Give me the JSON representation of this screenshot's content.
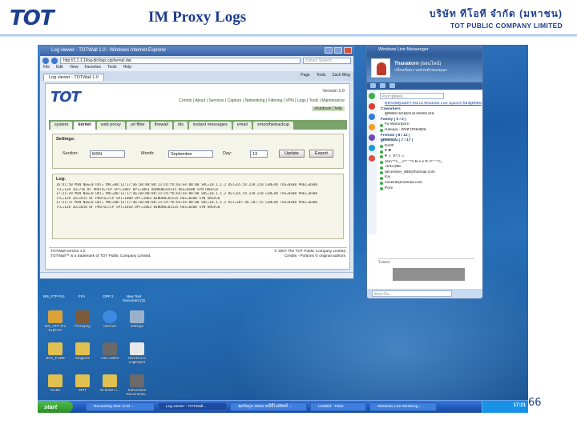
{
  "slide": {
    "logo": "TOT",
    "title": "IM Proxy Logs",
    "company_thai": "บริษัท ทีโอที จำกัด (มหาชน)",
    "company_eng": "TOT PUBLIC COMPANY LIMITED",
    "page_number": "66"
  },
  "browser": {
    "window_title": "Log viewer - TOTWall 1.0 - Windows Internet Explorer",
    "url": "http://1.1.1.1/log-dir/logs.cgi/kernel.dat",
    "search_placeholder": "Yahoo! Search",
    "menu": [
      "File",
      "Edit",
      "View",
      "Favorites",
      "Tools",
      "Help"
    ],
    "tab_label": "Log viewer - TOTWall 1.0",
    "tools": [
      "Page",
      "Tools",
      "Zach Blog"
    ]
  },
  "totwall": {
    "logo": "TOT",
    "version": "Version 1.0",
    "nav": "Control | About | Services | Capture | Networking | Filtering | VPN | Logs | Tools | Maintenance",
    "user_bar": "shutdown | help",
    "tabs": [
      "system",
      "kernel",
      "web proxy",
      "url filter",
      "firewall",
      "ids",
      "instant messages",
      "email",
      "smoothiebackup"
    ],
    "active_tab": "instant messages",
    "settings_title": "Settings:",
    "section_label": "Section:",
    "section_value": "MSN",
    "month_label": "Month:",
    "month_value": "September",
    "day_label": "Day:",
    "day_value": "13",
    "update_button": "Update",
    "export_button": "Export",
    "log_title": "Log:",
    "log_lines": [
      "16:41:50 MSN New=0 OUT= MAC=00:12:17:a6:a0:88:00:13:c4:fb:6a:ee:08:00 SRC=10.1.1.2 DST=65.54.239.210 LEN=48 TOS=0x00 PREC=0x00",
      "TTL=128 ID=716 DF PROTO=TCP SPT=1807 DPT=1863 WINDOW=65535 RES=0x00 SYN URGP=0",
      "17:21:29 MSN New=0 OUT= MAC=00:13:17:a6:a0:88:00:13:c4:fb:6a:ee:08:00 SRC=10.1.1.2 DST=65.54.239.210 LEN=48 TOS=0x00 PREC=0x00",
      "TTL=128 ID=1915 DF PROTO=TCP SPT=1809 DPT=1863 WINDOW=65535 RES=0x00 SYN URGP=0",
      "17:21:37 MSN New=0 OUT= MAC=00:13:17:a6:a0:88:00:13:c4:fb:6a:ee:08:00 SRC=10.1.1.2 DST=207.46.107.55 LEN=48 TOS=0x00 PREC=0x00",
      "TTL=128 ID=1818 DF PROTO=TCP SPT=1810 DPT=1863 WINDOW=65535 RES=0x00 SYN URGP=0"
    ],
    "footer_left_1": "TOTWall version 1.0",
    "footer_left_2": "TOTWall™ is a trademark of TOT Public Company Limited.",
    "footer_right_1": "© 2007 The TOT Public Company Limited",
    "footer_right_2": "Credits - Portions © original authors"
  },
  "messenger": {
    "window_title": "Windows Live Messenger",
    "name": "Thanakorn",
    "status": "(ออนไลน์)",
    "personal_message": "<ป้อนข้อความส่วนตัวของคุณ>",
    "search_placeholder": "ค้นหาผู้ติดต่อ...",
    "contacts": [
      {
        "text": "คลิกเพื่อดูเนื้อหาใหม่ใน Windows Live Spaces ของผู้ติดต่อ",
        "kind": "link"
      },
      {
        "text": "Coworkers",
        "kind": "group"
      },
      {
        "text": "ผู้ติดต่อในกลุ่มนี้ไม่ได้ออนไลน์",
        "kind": "item"
      },
      {
        "text": "Family ( 0 / 2 )",
        "kind": "group"
      },
      {
        "text": "Fa Warunporn",
        "kind": "item"
      },
      {
        "text": "Hasupa - ต้นทางของคุณ",
        "kind": "item"
      },
      {
        "text": "Friends ( 8 / 12 )",
        "kind": "group"
      },
      {
        "text": "ผู้ติดต่ออื่น ( 7 / 17 )",
        "kind": "group"
      },
      {
        "text": "Earth",
        "kind": "item"
      },
      {
        "text": "♥ ❀",
        "kind": "item"
      },
      {
        "text": "♥ ☺ ห้าว ☺",
        "kind": "item"
      },
      {
        "text": "Jsm'°*¤,¸¸,¤*°`°*¤ B e e R ¤*°`°*¤,¸",
        "kind": "item"
      },
      {
        "text": "ไม่ระบุชื่อ",
        "kind": "item"
      },
      {
        "text": "december_888@hotmail.com",
        "kind": "item"
      },
      {
        "text": "Kai",
        "kind": "item"
      },
      {
        "text": "minekiti@hotmail.com",
        "kind": "item"
      },
      {
        "text": "Pore",
        "kind": "item"
      }
    ],
    "ad_label": "โฆษณา",
    "bottom_placeholder": "ค้นหาเว็บ..."
  },
  "desktop_icons": [
    {
      "label": "WS_FTP Pro Explorer",
      "color": "#d9a33a"
    },
    {
      "label": "Photopeg",
      "color": "#7d5a3a"
    },
    {
      "label": "Internet",
      "color": "#3d8be0"
    },
    {
      "label": "settings",
      "color": "#9ab0c8"
    },
    {
      "label": "JDO_FUDE",
      "color": "#e0c050"
    },
    {
      "label": "Singsore",
      "color": "#e0c050"
    },
    {
      "label": "Auto-Safe2",
      "color": "#6a6a6a"
    },
    {
      "label": "Shortcut to LogExpert",
      "color": "#e8e8e8"
    },
    {
      "label": "DCIM",
      "color": "#e0c050"
    },
    {
      "label": "SPIT",
      "color": "#e0c050"
    },
    {
      "label": "ns-ticket-n...",
      "color": "#e0c050"
    },
    {
      "label": "Subversion Documenta...",
      "color": "#6a6a6a"
    }
  ],
  "desktop_top_labels": [
    "WS_FTP Pro",
    "FFA",
    "DPP 2",
    "New Text Document (3)"
  ],
  "taskbar": {
    "start": "start",
    "tasks": [
      "Remaining time: 5:34 ...",
      "Log viewer - TOTWall...",
      "ชุดข้อมูล จดหมายนี้นี้ไม่มีสิทธิ์ ...",
      "Untitled - Paint",
      "Windows Live Messeng..."
    ],
    "clock": "17:21"
  }
}
